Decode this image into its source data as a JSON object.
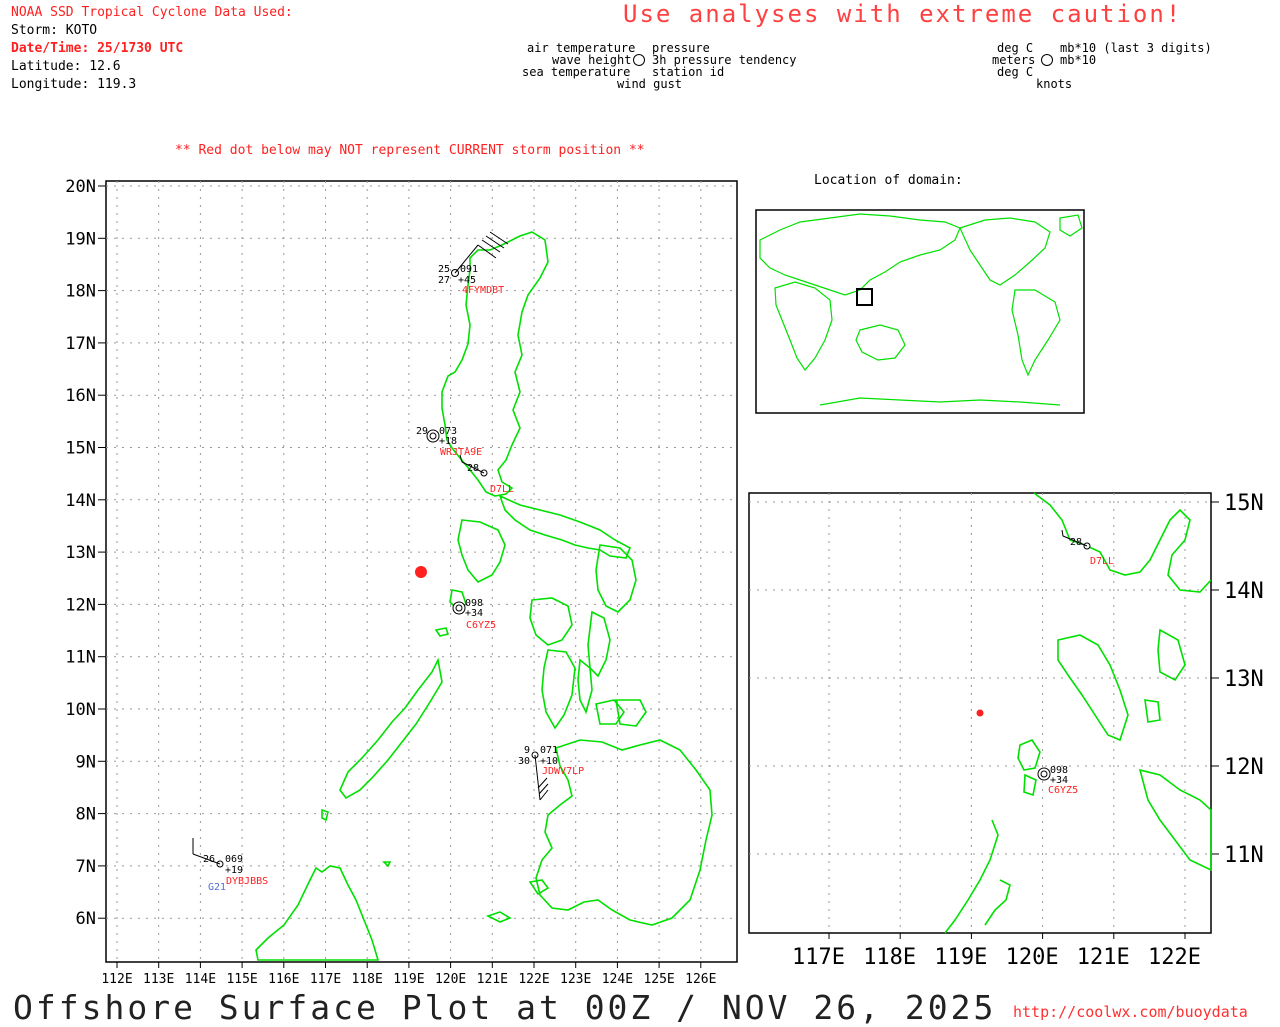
{
  "header": {
    "source": "NOAA SSD Tropical Cyclone Data Used:",
    "storm": "Storm: KOTO",
    "datetime": "Date/Time: 25/1730 UTC",
    "latitude": "Latitude: 12.6",
    "longitude": "Longitude: 119.3"
  },
  "caution": "Use analyses with extreme caution!",
  "legend_left": {
    "air_temp": "air temperature",
    "pressure": "pressure",
    "wave_height": "wave height",
    "tendency": "3h pressure tendency",
    "sea_temp": "sea temperature",
    "station_id": "station id",
    "wind_gust": "wind gust"
  },
  "legend_right": {
    "deg_c_top": "deg C",
    "mb_top": "mb*10 (last 3 digits)",
    "meters": "meters",
    "mb_mid": "mb*10",
    "deg_c_bottom": "deg C",
    "knots": "knots"
  },
  "note": "** Red dot below may NOT represent CURRENT storm position **",
  "inset_title": "Location of domain:",
  "main_map": {
    "lat_labels": [
      "20N",
      "19N",
      "18N",
      "17N",
      "16N",
      "15N",
      "14N",
      "13N",
      "12N",
      "11N",
      "10N",
      "9N",
      "8N",
      "7N",
      "6N"
    ],
    "lon_labels": [
      "112E",
      "113E",
      "114E",
      "115E",
      "116E",
      "117E",
      "118E",
      "119E",
      "120E",
      "121E",
      "122E",
      "123E",
      "124E",
      "125E",
      "126E"
    ],
    "storm_position": {
      "lat": 12.6,
      "lon": 119.3
    }
  },
  "zoom_map": {
    "lat_labels": [
      "15N",
      "14N",
      "13N",
      "12N",
      "11N"
    ],
    "lon_labels": [
      "117E",
      "118E",
      "119E",
      "120E",
      "121E",
      "122E"
    ]
  },
  "stations": [
    {
      "id": "4FYMDBT",
      "air": "25",
      "pressure": "091",
      "sea": "27",
      "tendency": "+45"
    },
    {
      "id": "WRJTA9E",
      "air": "29",
      "pressure": "073",
      "tendency": "+18"
    },
    {
      "id": "D7LL",
      "air": "28"
    },
    {
      "id": "C6YZ5",
      "pressure": "098",
      "tendency": "+34"
    },
    {
      "id": "JDWV7LP",
      "air": "9",
      "pressure": "071",
      "sea": "30",
      "tendency": "+10"
    },
    {
      "id": "DYBJBBS",
      "air": "26",
      "pressure": "069",
      "tendency": "+19",
      "gust": "G21"
    }
  ],
  "footer": {
    "title": "Offshore Surface Plot at 00Z / NOV 26, 2025",
    "url": "http://coolwx.com/buoydata"
  },
  "colors": {
    "land": "#00e000",
    "alert": "#ff2020",
    "gust": "#5070d0"
  }
}
